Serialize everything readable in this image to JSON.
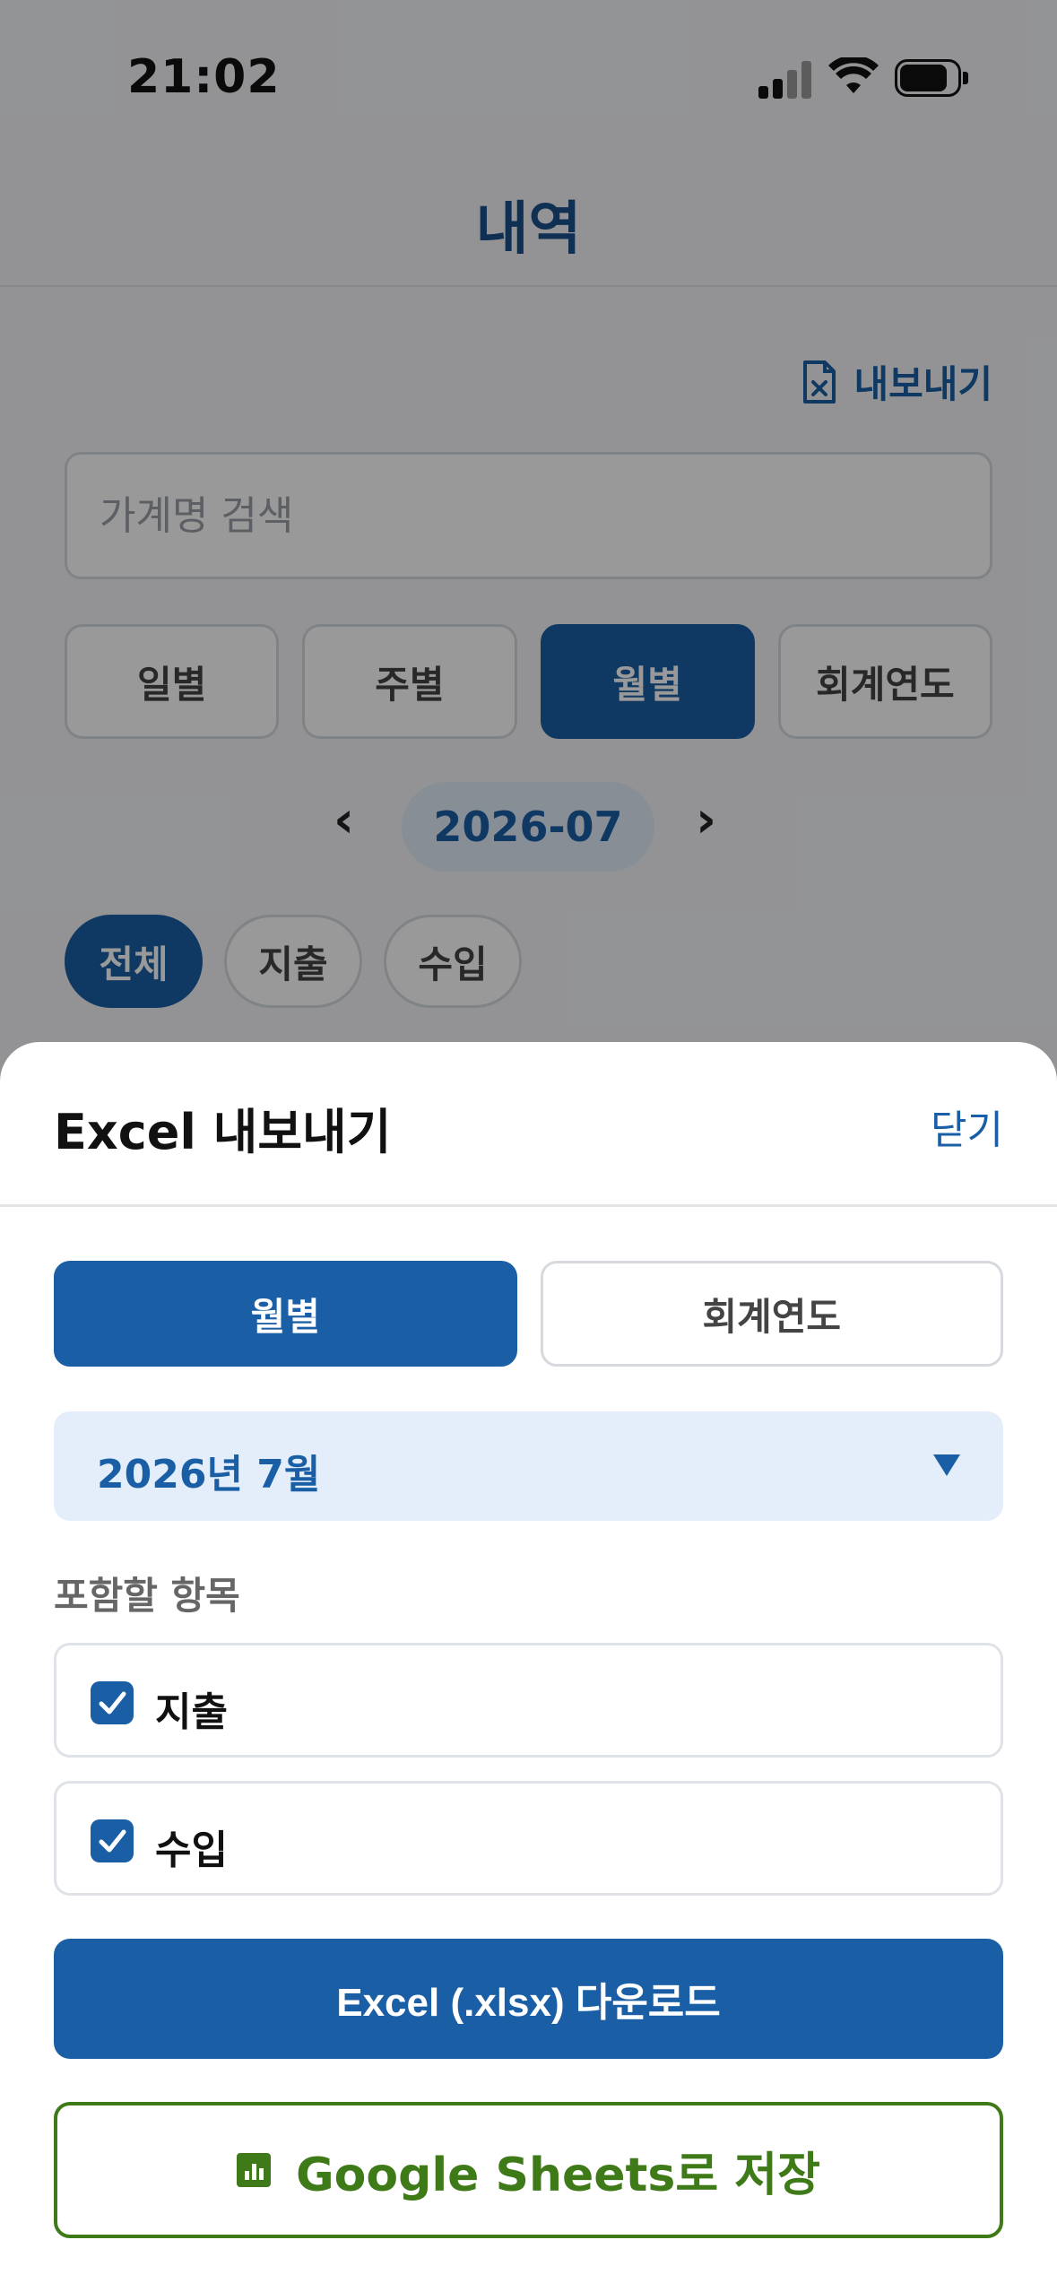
{
  "status_bar": {
    "time": "21:02"
  },
  "header": {
    "title": "내역"
  },
  "toolbar": {
    "export_label": "내보내기"
  },
  "search": {
    "placeholder": "가계명 검색"
  },
  "period_tabs": [
    {
      "label": "일별",
      "active": false
    },
    {
      "label": "주별",
      "active": false
    },
    {
      "label": "월별",
      "active": true
    },
    {
      "label": "회계연도",
      "active": false
    }
  ],
  "date_nav": {
    "prev": "‹",
    "value": "2026-07",
    "next": "›"
  },
  "type_chips": [
    {
      "label": "전체",
      "active": true
    },
    {
      "label": "지출",
      "active": false
    },
    {
      "label": "수입",
      "active": false
    }
  ],
  "export_sheet": {
    "title": "Excel 내보내기",
    "close_label": "닫기",
    "mode_tabs": [
      {
        "label": "월별",
        "active": true
      },
      {
        "label": "회계연도",
        "active": false
      }
    ],
    "month_select": {
      "value": "2026년 7월"
    },
    "include_label": "포함할 항목",
    "options": [
      {
        "label": "지출",
        "checked": true
      },
      {
        "label": "수입",
        "checked": true
      }
    ],
    "download_label": "Excel (.xlsx) 다운로드",
    "sheets_label": "Google Sheets로 저장"
  },
  "colors": {
    "primary": "#1a5fa6",
    "sheets_green": "#3f7a19",
    "overlay": "rgba(0,0,0,0.4)"
  },
  "icons": [
    "signal-icon",
    "wifi-icon",
    "battery-icon",
    "excel-file-icon",
    "chevron-left-icon",
    "chevron-right-icon",
    "caret-down-icon",
    "checkbox-checked-icon",
    "google-sheets-icon"
  ]
}
